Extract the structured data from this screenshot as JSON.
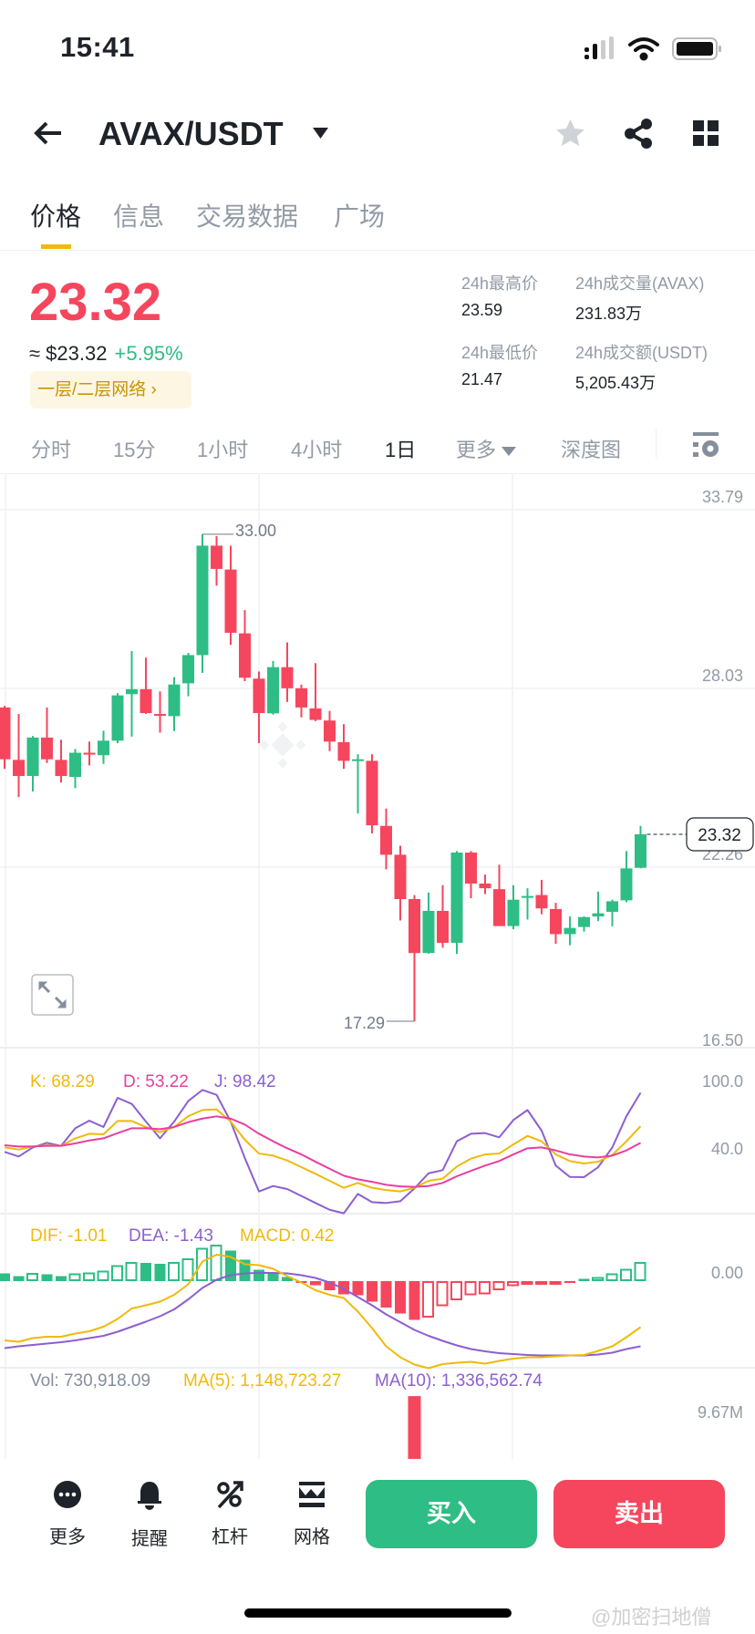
{
  "status_bar": {
    "time": "15:41"
  },
  "header": {
    "pair": "AVAX/USDT",
    "icons": [
      "back-arrow-icon",
      "dropdown-icon",
      "star-icon",
      "share-icon",
      "grid-icon"
    ]
  },
  "tabs": [
    "价格",
    "信息",
    "交易数据",
    "广场"
  ],
  "price": {
    "last": "23.32",
    "usd": "≈ $23.32",
    "change": "+5.95%",
    "network_badge": "一层/二层网络 ›"
  },
  "stats": [
    {
      "label": "24h最高价",
      "value": "23.59"
    },
    {
      "label": "24h成交量(AVAX)",
      "value": "231.83万"
    },
    {
      "label": "24h最低价",
      "value": "21.47"
    },
    {
      "label": "24h成交额(USDT)",
      "value": "5,205.43万"
    }
  ],
  "intervals": [
    "分时",
    "15分",
    "1小时",
    "4小时",
    "1日",
    "更多",
    "深度图"
  ],
  "active_interval": "1日",
  "colors": {
    "up": "#2ebd85",
    "down": "#f6465d",
    "accent": "#f0b90b",
    "k": "#f0b90b",
    "d": "#e93e9f",
    "j": "#8c5fd0"
  },
  "chart_data": {
    "type": "candlestick",
    "ylim": [
      16.5,
      33.79
    ],
    "price_axis_labels": [
      "33.79",
      "28.03",
      "22.26",
      "16.50"
    ],
    "high_annotation": "33.00",
    "low_annotation": "17.29",
    "current_price": "23.32",
    "watermark": "BINANCE",
    "candles": [
      [
        27.41,
        27.46,
        25.43,
        25.74
      ],
      [
        25.72,
        27.2,
        24.52,
        25.2
      ],
      [
        25.2,
        26.49,
        24.7,
        26.44
      ],
      [
        26.44,
        27.41,
        25.62,
        25.74
      ],
      [
        25.72,
        26.37,
        24.99,
        25.2
      ],
      [
        25.17,
        26.07,
        24.81,
        25.95
      ],
      [
        25.95,
        26.31,
        25.54,
        25.89
      ],
      [
        25.87,
        26.66,
        25.59,
        26.34
      ],
      [
        26.34,
        27.87,
        26.26,
        27.8
      ],
      [
        27.84,
        29.23,
        26.47,
        28.0
      ],
      [
        28.0,
        29.02,
        27.2,
        27.23
      ],
      [
        27.2,
        27.93,
        26.6,
        27.15
      ],
      [
        27.13,
        28.39,
        26.65,
        28.15
      ],
      [
        28.19,
        29.17,
        27.77,
        29.1
      ],
      [
        29.1,
        33.0,
        28.53,
        32.63
      ],
      [
        32.63,
        32.94,
        31.34,
        31.88
      ],
      [
        31.86,
        32.63,
        29.43,
        29.82
      ],
      [
        29.8,
        30.55,
        28.26,
        28.37
      ],
      [
        28.34,
        28.57,
        26.26,
        27.23
      ],
      [
        27.22,
        28.91,
        27.18,
        28.71
      ],
      [
        28.71,
        29.51,
        27.59,
        28.03
      ],
      [
        28.03,
        28.15,
        27.09,
        27.41
      ],
      [
        27.38,
        28.84,
        26.97,
        27.01
      ],
      [
        26.99,
        27.3,
        26.0,
        26.31
      ],
      [
        26.29,
        26.87,
        25.43,
        25.69
      ],
      [
        25.7,
        25.9,
        23.99,
        25.74
      ],
      [
        25.69,
        25.9,
        23.35,
        23.61
      ],
      [
        23.59,
        24.15,
        22.19,
        22.66
      ],
      [
        22.66,
        22.95,
        20.54,
        21.23
      ],
      [
        21.23,
        21.36,
        17.29,
        19.49
      ],
      [
        19.49,
        21.44,
        19.47,
        20.85
      ],
      [
        20.85,
        21.68,
        19.66,
        19.82
      ],
      [
        19.82,
        22.78,
        19.46,
        22.73
      ],
      [
        22.73,
        22.78,
        21.26,
        21.73
      ],
      [
        21.73,
        22.02,
        21.39,
        21.58
      ],
      [
        21.55,
        22.34,
        20.36,
        20.36
      ],
      [
        20.36,
        21.68,
        20.26,
        21.21
      ],
      [
        21.29,
        21.58,
        20.57,
        21.33
      ],
      [
        21.36,
        21.85,
        20.74,
        20.93
      ],
      [
        20.91,
        21.11,
        19.79,
        20.1
      ],
      [
        20.1,
        20.67,
        19.74,
        20.3
      ],
      [
        20.33,
        20.67,
        20.18,
        20.65
      ],
      [
        20.67,
        21.47,
        20.52,
        20.77
      ],
      [
        20.82,
        21.21,
        20.35,
        21.16
      ],
      [
        21.19,
        22.78,
        21.13,
        22.22
      ],
      [
        22.24,
        23.59,
        22.22,
        23.32
      ]
    ],
    "kdj": {
      "legend": {
        "k": "K: 68.29",
        "d": "D: 53.22",
        "j": "J: 98.42"
      },
      "axis_labels": [
        "100.0",
        "40.0"
      ],
      "k": [
        49.1,
        47.2,
        49.9,
        51.0,
        50.5,
        57.3,
        61.4,
        60.9,
        72.9,
        72.9,
        67.5,
        62.8,
        67.5,
        77.3,
        82.8,
        83.4,
        72.4,
        56.0,
        43.6,
        41.7,
        37.3,
        31.3,
        25.3,
        19.0,
        12.7,
        17.1,
        12.7,
        10.7,
        9.4,
        12.7,
        19.0,
        20.9,
        31.8,
        39.0,
        42.8,
        43.6,
        51.8,
        59.5,
        54.6,
        42.8,
        36.8,
        34.6,
        36.2,
        42.3,
        54.6,
        68.29
      ],
      "d": [
        51.0,
        49.9,
        49.9,
        50.5,
        50.5,
        52.7,
        55.4,
        57.3,
        62.0,
        66.4,
        66.4,
        65.5,
        67.5,
        71.9,
        75.1,
        77.1,
        75.1,
        69.7,
        61.4,
        54.6,
        48.3,
        42.8,
        36.2,
        29.9,
        23.6,
        20.3,
        18.1,
        15.4,
        14.0,
        13.5,
        14.3,
        17.1,
        23.1,
        28.0,
        32.7,
        36.8,
        42.8,
        48.3,
        49.1,
        46.4,
        42.8,
        40.9,
        40.1,
        41.7,
        46.4,
        53.22
      ],
      "j": [
        45.0,
        40.9,
        49.1,
        53.2,
        50.5,
        66.4,
        73.2,
        67.5,
        93.8,
        88.3,
        72.4,
        57.3,
        72.4,
        91.0,
        100.9,
        96.5,
        72.4,
        39.5,
        9.4,
        14.3,
        11.6,
        5.3,
        -1.0,
        -7.1,
        -10.3,
        7.2,
        -0.2,
        -1.0,
        0.6,
        12.1,
        25.8,
        28.6,
        54.6,
        61.4,
        62.0,
        58.2,
        73.8,
        82.8,
        64.2,
        32.7,
        22.5,
        22.3,
        31.3,
        49.1,
        77.3,
        98.42
      ]
    },
    "macd": {
      "legend": {
        "dif": "DIF: -1.01",
        "dea": "DEA: -1.43",
        "macd": "MACD: 0.42"
      },
      "axis_label": "0.00",
      "dif": [
        -1.3,
        -1.33,
        -1.25,
        -1.22,
        -1.22,
        -1.15,
        -1.1,
        -1.0,
        -0.83,
        -0.6,
        -0.53,
        -0.45,
        -0.3,
        -0.07,
        0.43,
        0.58,
        0.53,
        0.37,
        0.35,
        0.27,
        0.11,
        -0.03,
        -0.2,
        -0.3,
        -0.37,
        -0.67,
        -1.03,
        -1.43,
        -1.67,
        -1.83,
        -1.91,
        -1.82,
        -1.79,
        -1.77,
        -1.81,
        -1.75,
        -1.7,
        -1.67,
        -1.67,
        -1.65,
        -1.63,
        -1.62,
        -1.53,
        -1.43,
        -1.23,
        -1.01
      ],
      "dea": [
        -1.47,
        -1.43,
        -1.4,
        -1.37,
        -1.34,
        -1.3,
        -1.25,
        -1.2,
        -1.11,
        -1.0,
        -0.89,
        -0.77,
        -0.62,
        -0.4,
        -0.15,
        0.03,
        0.13,
        0.17,
        0.18,
        0.18,
        0.17,
        0.13,
        0.07,
        -0.03,
        -0.17,
        -0.35,
        -0.53,
        -0.73,
        -0.9,
        -1.07,
        -1.2,
        -1.31,
        -1.41,
        -1.49,
        -1.54,
        -1.58,
        -1.6,
        -1.62,
        -1.63,
        -1.63,
        -1.63,
        -1.63,
        -1.61,
        -1.57,
        -1.49,
        -1.43
      ],
      "hist": [
        0.17,
        0.11,
        0.18,
        0.15,
        0.11,
        0.17,
        0.19,
        0.23,
        0.35,
        0.42,
        0.4,
        0.38,
        0.42,
        0.5,
        0.73,
        0.8,
        0.67,
        0.47,
        0.25,
        0.18,
        0.09,
        -0.03,
        -0.09,
        -0.2,
        -0.29,
        -0.31,
        -0.45,
        -0.58,
        -0.71,
        -0.85,
        -0.8,
        -0.55,
        -0.42,
        -0.31,
        -0.29,
        -0.2,
        -0.11,
        -0.05,
        -0.03,
        -0.03,
        -0.03,
        0.05,
        0.09,
        0.17,
        0.27,
        0.42
      ],
      "hist_filled": [
        1,
        1,
        0,
        1,
        1,
        0,
        0,
        0,
        0,
        0,
        1,
        1,
        0,
        0,
        0,
        0,
        1,
        1,
        1,
        1,
        1,
        1,
        1,
        1,
        1,
        1,
        1,
        1,
        1,
        1,
        0,
        0,
        0,
        0,
        0,
        0,
        0,
        0,
        0,
        0,
        1,
        1,
        0,
        0,
        0,
        0
      ]
    },
    "volume": {
      "legend": {
        "vol": "Vol: 730,918.09",
        "ma5": "MA(5): 1,148,723.27",
        "ma10": "MA(10): 1,336,562.74"
      },
      "axis_label": "9.67M",
      "axis_value": 9670000,
      "visible_bars": [
        {
          "index": 29,
          "value": 10800000,
          "direction": "down"
        }
      ]
    }
  },
  "bottom_bar": {
    "items": [
      {
        "label": "更多",
        "icon": "more-icon"
      },
      {
        "label": "提醒",
        "icon": "bell-icon"
      },
      {
        "label": "杠杆",
        "icon": "leverage-icon"
      },
      {
        "label": "网格",
        "icon": "grid-trading-icon"
      }
    ],
    "buy": "买入",
    "sell": "卖出"
  },
  "watermark": "@加密扫地僧"
}
